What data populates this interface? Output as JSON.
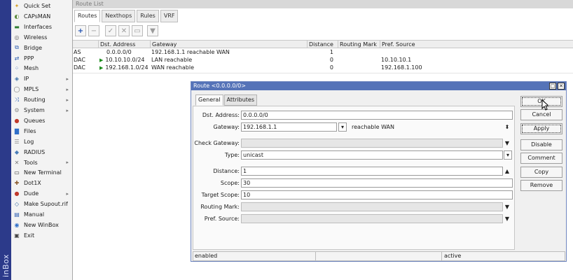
{
  "brand_strip": {
    "text": "inBox",
    "color": "#2c3a8a"
  },
  "menu": {
    "items": [
      {
        "label": "Quick Set",
        "icon": "wand-icon",
        "color": "#d7a12a",
        "arrow": false
      },
      {
        "label": "CAPsMAN",
        "icon": "capsman-icon",
        "color": "#5a8a3c",
        "arrow": false
      },
      {
        "label": "Interfaces",
        "icon": "interfaces-icon",
        "color": "#2e7d32",
        "arrow": false
      },
      {
        "label": "Wireless",
        "icon": "wireless-icon",
        "color": "#6a6a6a",
        "arrow": false
      },
      {
        "label": "Bridge",
        "icon": "bridge-icon",
        "color": "#2f5fb3",
        "arrow": false
      },
      {
        "label": "PPP",
        "icon": "ppp-icon",
        "color": "#2f5fb3",
        "arrow": false
      },
      {
        "label": "Mesh",
        "icon": "mesh-icon",
        "color": "#2f5fb3",
        "arrow": false
      },
      {
        "label": "IP",
        "icon": "ip-icon",
        "color": "#3a6ea5",
        "arrow": true
      },
      {
        "label": "MPLS",
        "icon": "mpls-icon",
        "color": "#6a6a6a",
        "arrow": true
      },
      {
        "label": "Routing",
        "icon": "routing-icon",
        "color": "#2f5fb3",
        "arrow": true
      },
      {
        "label": "System",
        "icon": "system-icon",
        "color": "#8a8a8a",
        "arrow": true
      },
      {
        "label": "Queues",
        "icon": "queues-icon",
        "color": "#c0392b",
        "arrow": false
      },
      {
        "label": "Files",
        "icon": "files-icon",
        "color": "#2f6fc9",
        "arrow": false
      },
      {
        "label": "Log",
        "icon": "log-icon",
        "color": "#8a8a8a",
        "arrow": false
      },
      {
        "label": "RADIUS",
        "icon": "radius-icon",
        "color": "#4a7db8",
        "arrow": false
      },
      {
        "label": "Tools",
        "icon": "tools-icon",
        "color": "#777777",
        "arrow": true
      },
      {
        "label": "New Terminal",
        "icon": "terminal-icon",
        "color": "#333333",
        "arrow": false
      },
      {
        "label": "Dot1X",
        "icon": "dot1x-icon",
        "color": "#8a5a2b",
        "arrow": false
      },
      {
        "label": "Dude",
        "icon": "dude-icon",
        "color": "#c0392b",
        "arrow": true
      },
      {
        "label": "Make Supout.rif",
        "icon": "supout-icon",
        "color": "#3a6ea5",
        "arrow": false
      },
      {
        "label": "Manual",
        "icon": "manual-icon",
        "color": "#2f5fb3",
        "arrow": false
      },
      {
        "label": "New WinBox",
        "icon": "winbox-icon",
        "color": "#2f6fc9",
        "arrow": false
      },
      {
        "label": "Exit",
        "icon": "exit-icon",
        "color": "#444444",
        "arrow": false
      }
    ]
  },
  "route_list": {
    "title": "Route List",
    "tabs": [
      "Routes",
      "Nexthops",
      "Rules",
      "VRF"
    ],
    "active_tab": "Routes",
    "toolbar": {
      "add": "+",
      "remove": "−",
      "enable": "✓",
      "disable": "✕",
      "comment": "▭",
      "filter": "▼"
    },
    "columns": [
      "Dst. Address",
      "Gateway",
      "Distance",
      "Routing Mark",
      "Pref. Source"
    ],
    "rows": [
      {
        "flags": "AS",
        "arrow": "",
        "dst": "0.0.0.0/0",
        "gateway": "192.168.1.1 reachable WAN",
        "distance": "1",
        "mark": "",
        "pref": ""
      },
      {
        "flags": "DAC",
        "arrow": "▶",
        "dst": "10.10.10.0/24",
        "gateway": "LAN reachable",
        "distance": "0",
        "mark": "",
        "pref": "10.10.10.1"
      },
      {
        "flags": "DAC",
        "arrow": "▶",
        "dst": "192.168.1.0/24",
        "gateway": "WAN reachable",
        "distance": "0",
        "mark": "",
        "pref": "192.168.1.100"
      }
    ]
  },
  "route_dialog": {
    "title": "Route <0.0.0.0/0>",
    "title_buttons": {
      "maximize": "□",
      "close": "✕"
    },
    "tabs": [
      "General",
      "Attributes"
    ],
    "active_tab": "General",
    "fields": {
      "dst_address": {
        "label": "Dst. Address:",
        "value": "0.0.0.0/0"
      },
      "gateway": {
        "label": "Gateway:",
        "value": "192.168.1.1",
        "status": "reachable WAN"
      },
      "check_gateway": {
        "label": "Check Gateway:",
        "value": ""
      },
      "type": {
        "label": "Type:",
        "value": "unicast"
      },
      "distance": {
        "label": "Distance:",
        "value": "1"
      },
      "scope": {
        "label": "Scope:",
        "value": "30"
      },
      "target_scope": {
        "label": "Target Scope:",
        "value": "10"
      },
      "routing_mark": {
        "label": "Routing Mark:",
        "value": ""
      },
      "pref_source": {
        "label": "Pref. Source:",
        "value": ""
      }
    },
    "controls": {
      "dropdown": "▼",
      "collapse": "▲",
      "updown": "⬍",
      "spin": "▾"
    },
    "buttons": {
      "ok": "OK",
      "cancel": "Cancel",
      "apply": "Apply",
      "disable": "Disable",
      "comment": "Comment",
      "copy": "Copy",
      "remove": "Remove"
    },
    "status": {
      "left": "enabled",
      "right": "active"
    }
  }
}
